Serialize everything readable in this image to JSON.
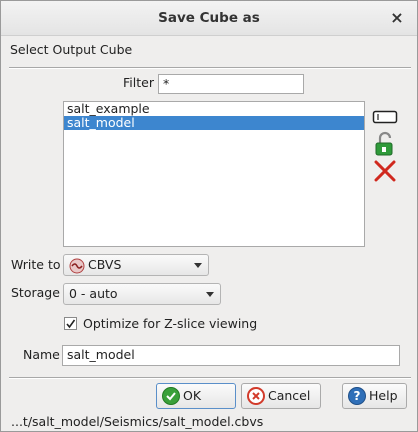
{
  "window": {
    "title": "Save Cube as",
    "close_glyph": "×"
  },
  "section_label": "Select Output Cube",
  "filter": {
    "label": "Filter",
    "value": "*"
  },
  "cube_list": {
    "items": [
      "salt_example",
      "salt_model"
    ],
    "selected_index": 1
  },
  "side_icons": [
    "rename-icon",
    "lock-open-icon",
    "delete-icon"
  ],
  "write_to": {
    "label": "Write to",
    "value": "CBVS",
    "icon": "cbvs-format-icon"
  },
  "storage": {
    "label": "Storage",
    "value": "0 - auto"
  },
  "optimize": {
    "label": "Optimize for Z-slice viewing",
    "checked": true
  },
  "name_field": {
    "label": "Name",
    "value": "salt_model"
  },
  "buttons": {
    "ok": "OK",
    "cancel": "Cancel",
    "help": "Help"
  },
  "file_path": "...t/salt_model/Seismics/salt_model.cbvs",
  "colors": {
    "selection": "#3d86cf",
    "ok_icon": "#3aa03a",
    "cancel_icon": "#d23a2a",
    "help_icon": "#2f6fb8"
  }
}
